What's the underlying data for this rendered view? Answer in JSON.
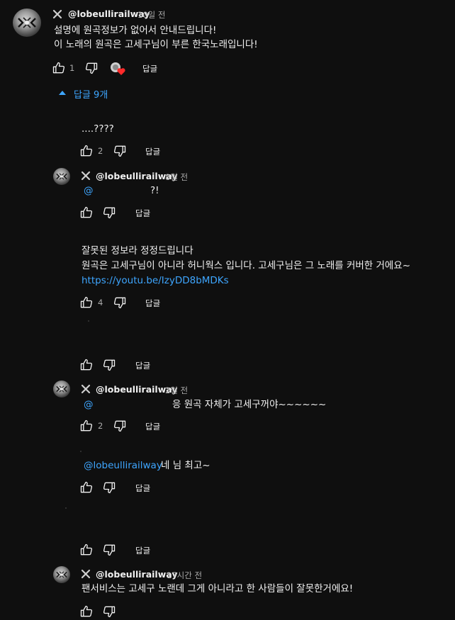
{
  "top_comment": {
    "author": "@lobeullirailway",
    "time": "10일 전",
    "lines": [
      "설명에 원곡정보가 없어서 안내드립니다!",
      "이 노래의 원곡은 고세구님이 부른 한국노래입니다!"
    ],
    "likes": "1",
    "reply_label": "답글",
    "heart_icon": "creator-heart-icon"
  },
  "replies_toggle": {
    "label": "답글 9개",
    "icon": "caret-up-icon"
  },
  "replies": [
    {
      "text": "....????",
      "likes": "2",
      "reply_label": "답글"
    },
    {
      "author": "@lobeullirailway",
      "time": "8일 전",
      "mention": "@",
      "text": "?!",
      "likes": "",
      "reply_label": "답글"
    },
    {
      "lines": [
        "잘못된 정보라 정정드립니다",
        "원곡은 고세구님이 아니라 허니웍스 입니다. 고세구님은 그 노래를 커버한 거에요~"
      ],
      "link": "https://youtu.be/IzyDD8bMDKs",
      "likes": "4",
      "reply_label": "답글"
    },
    {
      "reply_label": "답글"
    },
    {
      "author": "@lobeullirailway",
      "time": "2일 전",
      "mention": "@",
      "text": "응 원곡 자체가 고세구꺼야~~~~~~",
      "likes": "2",
      "reply_label": "답글"
    },
    {
      "mention": "@lobeullirailway",
      "text": "네 님 최고~",
      "reply_label": "답글"
    },
    {
      "reply_label": "답글"
    },
    {
      "author": "@lobeullirailway",
      "time": "17시간 전",
      "text": "팬서비스는 고세구 노랜데 그게 아니라고 한 사람들이 잘못한거에요!"
    }
  ],
  "colors": {
    "background": "#0f0f0f",
    "text": "#f1f1f1",
    "secondary": "#aaaaaa",
    "link": "#3ea6ff"
  }
}
